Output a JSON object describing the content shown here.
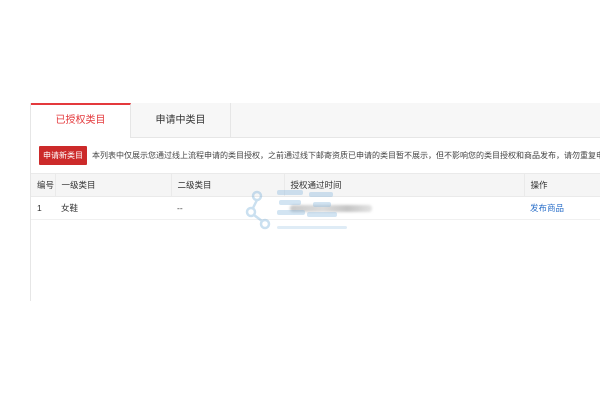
{
  "tabs": [
    {
      "label": "已授权类目",
      "active": true
    },
    {
      "label": "申请中类目",
      "active": false
    }
  ],
  "notice": {
    "button_label": "申请新类目",
    "text": "本列表中仅展示您通过线上流程申请的类目授权，之前通过线下邮寄资质已申请的类目暂不展示，但不影响您的类目授权和商品发布，请勿重复申请!"
  },
  "table": {
    "headers": [
      "编号",
      "一级类目",
      "二级类目",
      "授权通过时间",
      "操作"
    ],
    "rows": [
      {
        "index": "1",
        "category_1": "女鞋",
        "category_2": "--",
        "action": "发布商品"
      }
    ]
  },
  "colors": {
    "accent": "#e4393c",
    "button_bg": "#cc2a2a",
    "link": "#2a6fc9"
  },
  "icons": {
    "watermark": "watermark-logo-icon"
  }
}
